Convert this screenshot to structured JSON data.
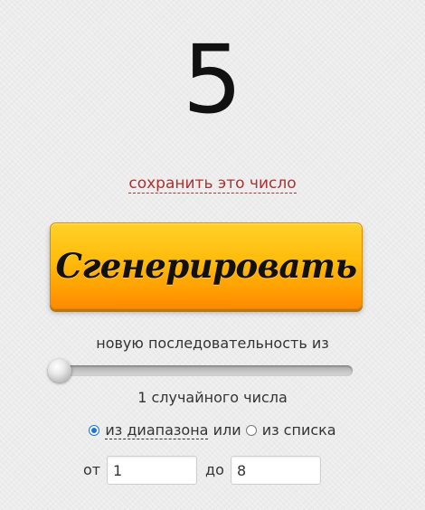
{
  "result": {
    "value": "5"
  },
  "save_link": {
    "label": "сохранить это число"
  },
  "generate_button": {
    "label": "Сгенерировать"
  },
  "sequence": {
    "label": "новую последовательность из",
    "count_text": "1 случайного числа",
    "slider_value": 1
  },
  "mode": {
    "range_label": "из диапазона",
    "or_text": "или",
    "list_label": "из списка",
    "selected": "range"
  },
  "range": {
    "from_label": "от",
    "from_value": "1",
    "to_label": "до",
    "to_value": "8"
  },
  "colors": {
    "link": "#a63434",
    "button_top": "#ffd12a",
    "button_bottom": "#ff8a00",
    "radio_checked": "#1a73e8"
  }
}
